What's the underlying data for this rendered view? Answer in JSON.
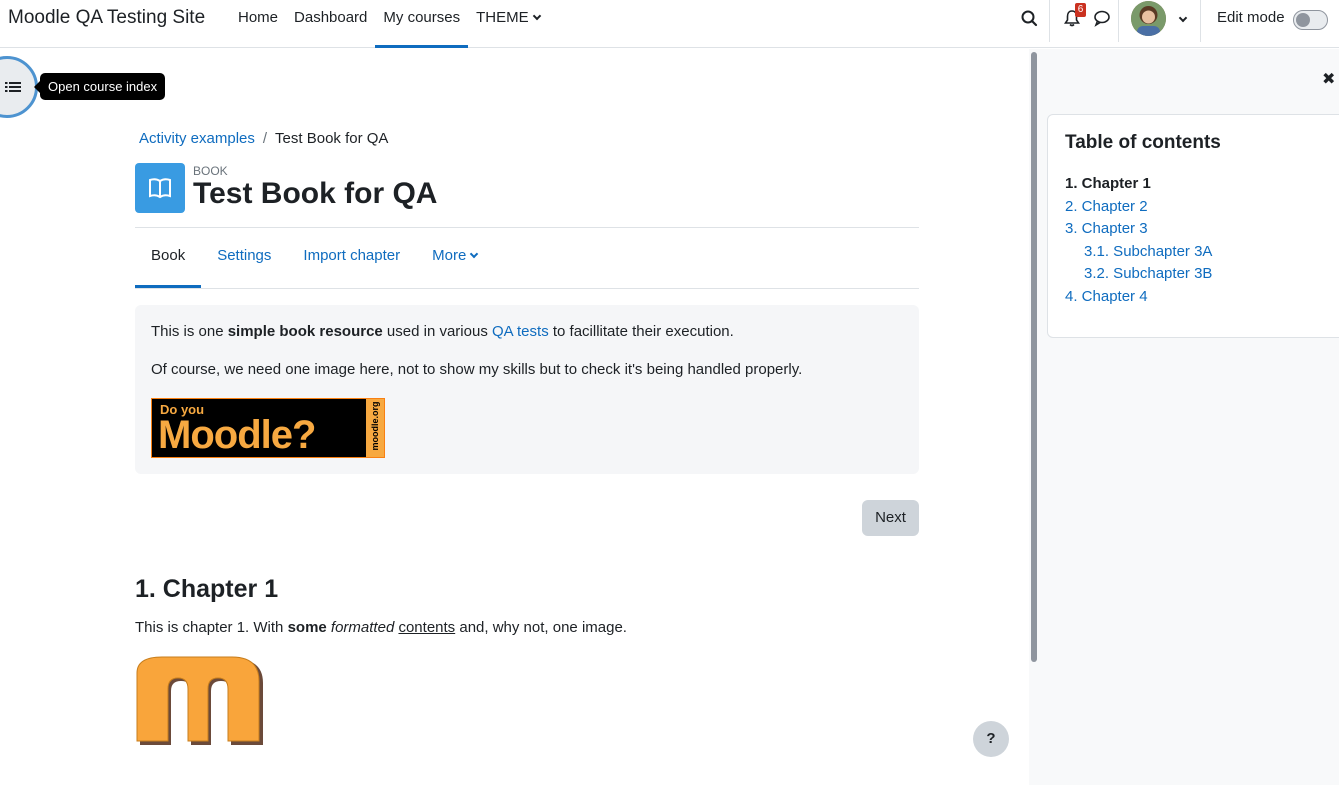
{
  "header": {
    "site_name": "Moodle QA Testing Site",
    "nav": [
      "Home",
      "Dashboard",
      "My courses",
      "THEME"
    ],
    "active_nav": "My courses",
    "notification_count": "6",
    "edit_mode_label": "Edit mode",
    "edit_mode_on": false
  },
  "course_index": {
    "tooltip": "Open course index"
  },
  "breadcrumb": {
    "parent": "Activity examples",
    "separator": "/",
    "current": "Test Book for QA"
  },
  "activity": {
    "kind": "BOOK",
    "title": "Test Book for QA"
  },
  "secondary_nav": {
    "tabs": [
      "Book",
      "Settings",
      "Import chapter",
      "More"
    ],
    "active": "Book"
  },
  "intro": {
    "p1_before": "This is one ",
    "p1_bold": "simple book resource",
    "p1_middle": " used in various ",
    "p1_link": "QA tests",
    "p1_after": " to facillitate their execution.",
    "p2": "Of course, we need one image here, not to show my skills but to check it's being handled properly.",
    "banner_line1": "Do you",
    "banner_line2": "Moodle?",
    "banner_side": "moodle.org"
  },
  "navigation": {
    "next_label": "Next"
  },
  "chapter": {
    "title": "1. Chapter 1",
    "text_before": "This is chapter 1. With ",
    "text_bold": "some",
    "text_italic": "formatted",
    "text_underline": "contents",
    "text_after": " and, why not, one image."
  },
  "help": {
    "label": "?"
  },
  "toc": {
    "title": "Table of contents",
    "items": [
      {
        "label": "1. Chapter 1",
        "current": true,
        "sub": false
      },
      {
        "label": "2. Chapter 2",
        "current": false,
        "sub": false
      },
      {
        "label": "3. Chapter 3",
        "current": false,
        "sub": false
      },
      {
        "label": "3.1. Subchapter 3A",
        "current": false,
        "sub": true
      },
      {
        "label": "3.2. Subchapter 3B",
        "current": false,
        "sub": true
      },
      {
        "label": "4. Chapter 4",
        "current": false,
        "sub": false
      }
    ]
  },
  "colors": {
    "link": "#0f6cbf",
    "book_icon_bg": "#399be2",
    "moodle_orange": "#f7a941",
    "badge": "#ca3120"
  },
  "icons": [
    "search-icon",
    "bell-icon",
    "chat-icon",
    "chevron-down-icon",
    "list-icon",
    "book-icon",
    "close-icon",
    "help-icon"
  ]
}
